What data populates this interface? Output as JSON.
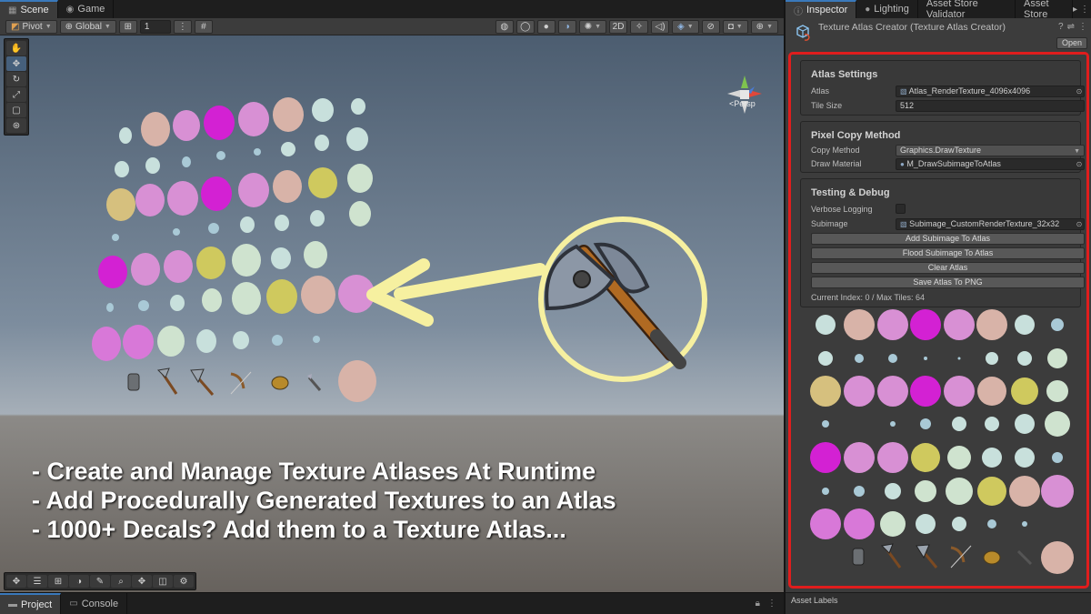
{
  "scene_tabs": [
    {
      "label": "Scene",
      "icon": "scene-icon"
    },
    {
      "label": "Game",
      "icon": "game-icon"
    }
  ],
  "toolbar": {
    "pivot": "Pivot",
    "global": "Global",
    "grid_value": "1",
    "mode_2d": "2D"
  },
  "viewport": {
    "persp_label": "<Persp"
  },
  "banner": {
    "line1": "- Create and Manage Texture Atlases At Runtime",
    "line2": "- Add Procedurally Generated Textures to an Atlas",
    "line3": "- 1000+ Decals? Add them to a Texture Atlas..."
  },
  "bottom_tabs": [
    {
      "label": "Project",
      "icon": "folder-icon"
    },
    {
      "label": "Console",
      "icon": "console-icon"
    }
  ],
  "inspector_tabs": [
    "Inspector",
    "Lighting",
    "Asset Store Validator",
    "Asset Store"
  ],
  "inspector": {
    "title": "Texture Atlas Creator (Texture Atlas Creator)",
    "open_label": "Open",
    "atlas_settings": {
      "title": "Atlas Settings",
      "atlas_label": "Atlas",
      "atlas_value": "Atlas_RenderTexture_4096x4096",
      "tile_size_label": "Tile Size",
      "tile_size_value": "512"
    },
    "pixel_copy": {
      "title": "Pixel Copy Method",
      "copy_method_label": "Copy Method",
      "copy_method_value": "Graphics.DrawTexture",
      "draw_material_label": "Draw Material",
      "draw_material_value": "M_DrawSubimageToAtlas"
    },
    "testing": {
      "title": "Testing & Debug",
      "verbose_label": "Verbose Logging",
      "subimage_label": "Subimage",
      "subimage_value": "Subimage_CustomRenderTexture_32x32",
      "add_button": "Add Subimage To Atlas",
      "flood_button": "Flood Subimage To Atlas",
      "clear_button": "Clear Atlas",
      "save_button": "Save Atlas To PNG",
      "status": "Current Index: 0 / Max Tiles: 64"
    },
    "asset_labels": "Asset Labels"
  },
  "colors": {
    "accent_red": "#e01d1d",
    "magenta": "#d321d3",
    "pink": "#d890d4",
    "peach": "#d8b3a8",
    "olive": "#cfc95e",
    "mint": "#cfe3cf",
    "cyan_light": "#c3e3e0",
    "tan": "#d6c07e",
    "arrow_yellow": "#f6f0a0"
  }
}
